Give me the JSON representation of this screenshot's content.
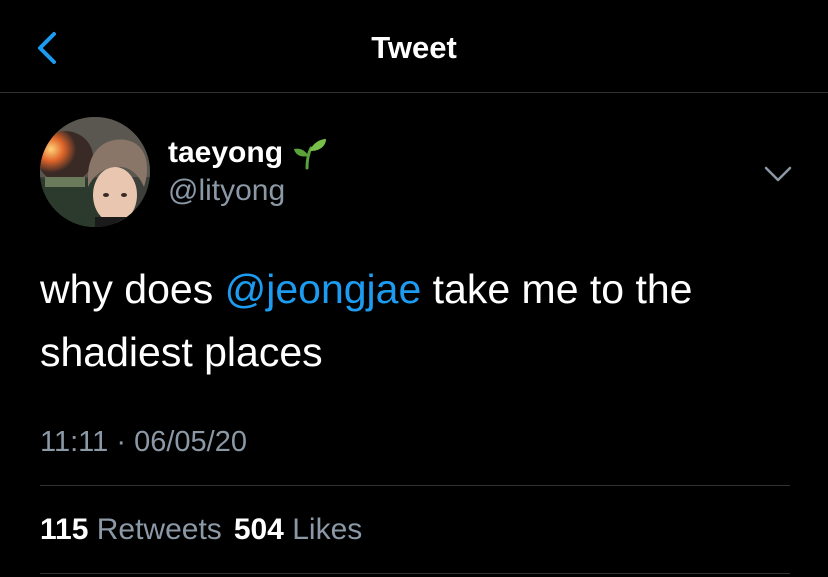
{
  "header": {
    "title": "Tweet",
    "back_icon": "chevron-left-icon"
  },
  "tweet": {
    "author": {
      "display_name": "taeyong",
      "name_emoji_icon": "sprout-icon",
      "handle": "@lityong"
    },
    "text_before_mention": "why does ",
    "mention": "@jeongjae",
    "text_after_mention": " take me to the shadiest places",
    "time": "11:11",
    "separator": "·",
    "date": "06/05/20",
    "retweets_count": "115",
    "retweets_label": "Retweets",
    "likes_count": "504",
    "likes_label": "Likes",
    "more_icon": "chevron-down-icon"
  },
  "colors": {
    "background": "#000000",
    "text": "#ffffff",
    "secondary_text": "#8b98a5",
    "accent": "#1d9bf0",
    "divider": "#2f3336"
  }
}
